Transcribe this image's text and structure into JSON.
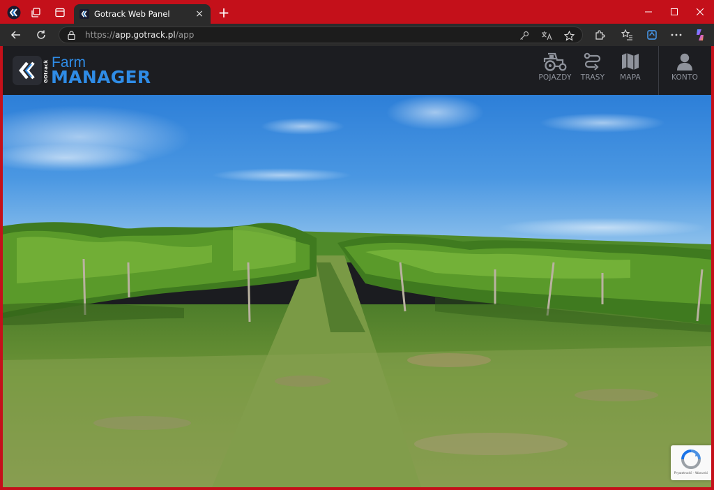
{
  "browser": {
    "tab_title": "Gotrack Web Panel",
    "url_scheme": "https://",
    "url_host": "app.gotrack.pl",
    "url_path": "/app",
    "new_tab": "+",
    "tab_close": "×"
  },
  "app": {
    "logo_brand": "GOtrack",
    "logo_line1": "Farm",
    "logo_line2": "MANAGER",
    "nav": [
      {
        "label": "POJAZDY",
        "icon": "tractor-icon"
      },
      {
        "label": "TRASY",
        "icon": "route-icon"
      },
      {
        "label": "MAPA",
        "icon": "map-icon"
      },
      {
        "label": "KONTO",
        "icon": "user-icon"
      }
    ],
    "accent": "#2f8ce6"
  },
  "recaptcha": {
    "text": "Prywatność - Warunki"
  }
}
